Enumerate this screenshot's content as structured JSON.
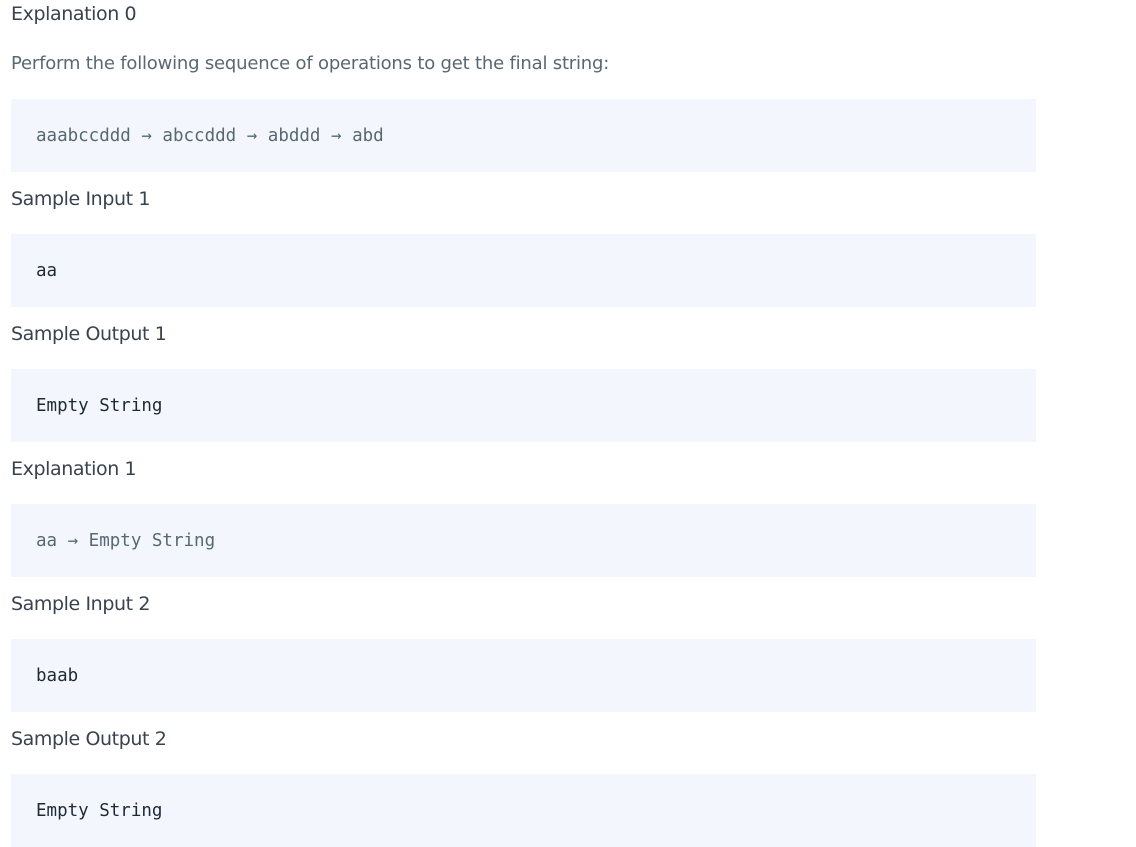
{
  "sections": {
    "explanation0": {
      "heading": "Explanation 0",
      "text": "Perform the following sequence of operations to get the final string:",
      "code": "aaabccddd → abccddd → abddd → abd"
    },
    "sample_input_1": {
      "heading": "Sample Input 1",
      "code": "aa"
    },
    "sample_output_1": {
      "heading": "Sample Output 1",
      "code": "Empty String"
    },
    "explanation1": {
      "heading": "Explanation 1",
      "code": "aa → Empty String"
    },
    "sample_input_2": {
      "heading": "Sample Input 2",
      "code": "baab"
    },
    "sample_output_2": {
      "heading": "Sample Output 2",
      "code": "Empty String"
    }
  }
}
